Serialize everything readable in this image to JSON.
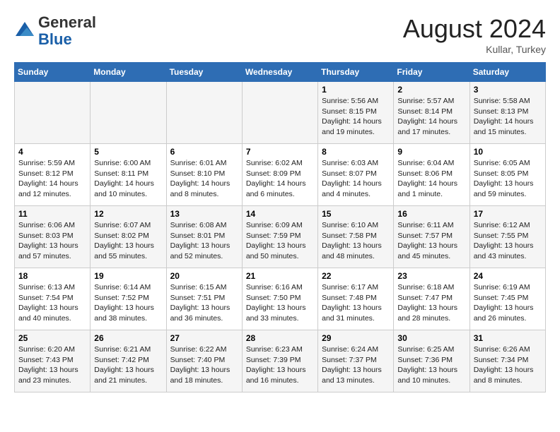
{
  "header": {
    "logo_line1": "General",
    "logo_line2": "Blue",
    "month_year": "August 2024",
    "location": "Kullar, Turkey"
  },
  "days_of_week": [
    "Sunday",
    "Monday",
    "Tuesday",
    "Wednesday",
    "Thursday",
    "Friday",
    "Saturday"
  ],
  "weeks": [
    [
      {
        "day": "",
        "info": ""
      },
      {
        "day": "",
        "info": ""
      },
      {
        "day": "",
        "info": ""
      },
      {
        "day": "",
        "info": ""
      },
      {
        "day": "1",
        "info": "Sunrise: 5:56 AM\nSunset: 8:15 PM\nDaylight: 14 hours\nand 19 minutes."
      },
      {
        "day": "2",
        "info": "Sunrise: 5:57 AM\nSunset: 8:14 PM\nDaylight: 14 hours\nand 17 minutes."
      },
      {
        "day": "3",
        "info": "Sunrise: 5:58 AM\nSunset: 8:13 PM\nDaylight: 14 hours\nand 15 minutes."
      }
    ],
    [
      {
        "day": "4",
        "info": "Sunrise: 5:59 AM\nSunset: 8:12 PM\nDaylight: 14 hours\nand 12 minutes."
      },
      {
        "day": "5",
        "info": "Sunrise: 6:00 AM\nSunset: 8:11 PM\nDaylight: 14 hours\nand 10 minutes."
      },
      {
        "day": "6",
        "info": "Sunrise: 6:01 AM\nSunset: 8:10 PM\nDaylight: 14 hours\nand 8 minutes."
      },
      {
        "day": "7",
        "info": "Sunrise: 6:02 AM\nSunset: 8:09 PM\nDaylight: 14 hours\nand 6 minutes."
      },
      {
        "day": "8",
        "info": "Sunrise: 6:03 AM\nSunset: 8:07 PM\nDaylight: 14 hours\nand 4 minutes."
      },
      {
        "day": "9",
        "info": "Sunrise: 6:04 AM\nSunset: 8:06 PM\nDaylight: 14 hours\nand 1 minute."
      },
      {
        "day": "10",
        "info": "Sunrise: 6:05 AM\nSunset: 8:05 PM\nDaylight: 13 hours\nand 59 minutes."
      }
    ],
    [
      {
        "day": "11",
        "info": "Sunrise: 6:06 AM\nSunset: 8:03 PM\nDaylight: 13 hours\nand 57 minutes."
      },
      {
        "day": "12",
        "info": "Sunrise: 6:07 AM\nSunset: 8:02 PM\nDaylight: 13 hours\nand 55 minutes."
      },
      {
        "day": "13",
        "info": "Sunrise: 6:08 AM\nSunset: 8:01 PM\nDaylight: 13 hours\nand 52 minutes."
      },
      {
        "day": "14",
        "info": "Sunrise: 6:09 AM\nSunset: 7:59 PM\nDaylight: 13 hours\nand 50 minutes."
      },
      {
        "day": "15",
        "info": "Sunrise: 6:10 AM\nSunset: 7:58 PM\nDaylight: 13 hours\nand 48 minutes."
      },
      {
        "day": "16",
        "info": "Sunrise: 6:11 AM\nSunset: 7:57 PM\nDaylight: 13 hours\nand 45 minutes."
      },
      {
        "day": "17",
        "info": "Sunrise: 6:12 AM\nSunset: 7:55 PM\nDaylight: 13 hours\nand 43 minutes."
      }
    ],
    [
      {
        "day": "18",
        "info": "Sunrise: 6:13 AM\nSunset: 7:54 PM\nDaylight: 13 hours\nand 40 minutes."
      },
      {
        "day": "19",
        "info": "Sunrise: 6:14 AM\nSunset: 7:52 PM\nDaylight: 13 hours\nand 38 minutes."
      },
      {
        "day": "20",
        "info": "Sunrise: 6:15 AM\nSunset: 7:51 PM\nDaylight: 13 hours\nand 36 minutes."
      },
      {
        "day": "21",
        "info": "Sunrise: 6:16 AM\nSunset: 7:50 PM\nDaylight: 13 hours\nand 33 minutes."
      },
      {
        "day": "22",
        "info": "Sunrise: 6:17 AM\nSunset: 7:48 PM\nDaylight: 13 hours\nand 31 minutes."
      },
      {
        "day": "23",
        "info": "Sunrise: 6:18 AM\nSunset: 7:47 PM\nDaylight: 13 hours\nand 28 minutes."
      },
      {
        "day": "24",
        "info": "Sunrise: 6:19 AM\nSunset: 7:45 PM\nDaylight: 13 hours\nand 26 minutes."
      }
    ],
    [
      {
        "day": "25",
        "info": "Sunrise: 6:20 AM\nSunset: 7:43 PM\nDaylight: 13 hours\nand 23 minutes."
      },
      {
        "day": "26",
        "info": "Sunrise: 6:21 AM\nSunset: 7:42 PM\nDaylight: 13 hours\nand 21 minutes."
      },
      {
        "day": "27",
        "info": "Sunrise: 6:22 AM\nSunset: 7:40 PM\nDaylight: 13 hours\nand 18 minutes."
      },
      {
        "day": "28",
        "info": "Sunrise: 6:23 AM\nSunset: 7:39 PM\nDaylight: 13 hours\nand 16 minutes."
      },
      {
        "day": "29",
        "info": "Sunrise: 6:24 AM\nSunset: 7:37 PM\nDaylight: 13 hours\nand 13 minutes."
      },
      {
        "day": "30",
        "info": "Sunrise: 6:25 AM\nSunset: 7:36 PM\nDaylight: 13 hours\nand 10 minutes."
      },
      {
        "day": "31",
        "info": "Sunrise: 6:26 AM\nSunset: 7:34 PM\nDaylight: 13 hours\nand 8 minutes."
      }
    ]
  ]
}
